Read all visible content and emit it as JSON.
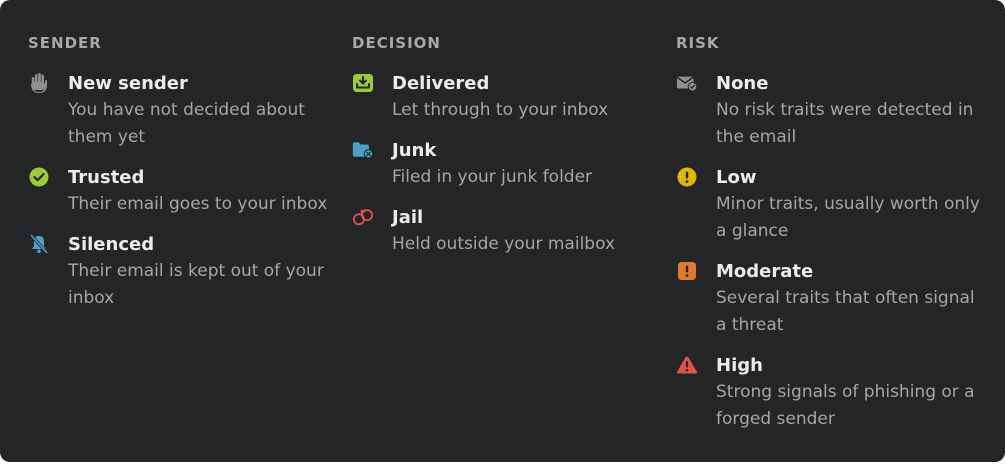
{
  "columns": {
    "sender": {
      "header": "SENDER",
      "items": [
        {
          "icon": "hand-icon",
          "title": "New sender",
          "desc": "You have not decided about them yet",
          "color": "#8f8f8f"
        },
        {
          "icon": "check-circle-icon",
          "title": "Trusted",
          "desc": "Their email goes to your inbox",
          "color": "#9acd32"
        },
        {
          "icon": "bell-slash-icon",
          "title": "Silenced",
          "desc": "Their email is kept out of your inbox",
          "color": "#4aa3c7"
        }
      ]
    },
    "decision": {
      "header": "DECISION",
      "items": [
        {
          "icon": "inbox-tray-icon",
          "title": "Delivered",
          "desc": "Let through to your inbox",
          "color": "#9acd32"
        },
        {
          "icon": "folder-x-icon",
          "title": "Junk",
          "desc": "Filed in your junk folder",
          "color": "#4aa3c7"
        },
        {
          "icon": "handcuffs-icon",
          "title": "Jail",
          "desc": "Held outside your mailbox",
          "color": "#e0524a"
        }
      ]
    },
    "risk": {
      "header": "RISK",
      "items": [
        {
          "icon": "envelope-check-icon",
          "title": "None",
          "desc": "No risk traits were detected in the email",
          "color": "#8f8f8f"
        },
        {
          "icon": "exclamation-circle-icon",
          "title": "Low",
          "desc": "Minor traits, usually worth only a glance",
          "color": "#e0b800"
        },
        {
          "icon": "exclamation-square-icon",
          "title": "Moderate",
          "desc": "Several traits that often signal a threat",
          "color": "#e07b2e"
        },
        {
          "icon": "warning-triangle-icon",
          "title": "High",
          "desc": "Strong signals of phishing or a forged sender",
          "color": "#e0524a"
        }
      ]
    }
  }
}
